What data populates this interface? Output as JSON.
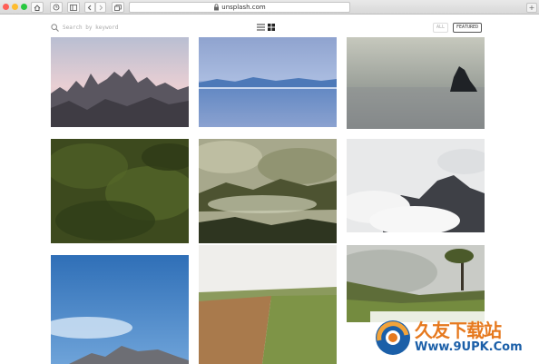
{
  "browser": {
    "address_bar": "unsplash.com",
    "new_tab_label": "+",
    "traffic_colors": [
      "#ff5f57",
      "#febc2e",
      "#28c840"
    ]
  },
  "toolbar": {
    "search_placeholder": "Search by keyword",
    "filter_all": "ALL",
    "filter_featured": "FEATURED"
  },
  "photos": [
    {
      "subject": "mountain-peaks-pink-sky"
    },
    {
      "subject": "blue-mountain-lake"
    },
    {
      "subject": "sea-rock-fog"
    },
    {
      "subject": "green-forest-aerial"
    },
    {
      "subject": "misty-green-hills"
    },
    {
      "subject": "cloudy-mountains"
    },
    {
      "subject": "blue-sky-mountain"
    },
    {
      "subject": "farm-field"
    },
    {
      "subject": "foggy-tree-meadow"
    }
  ],
  "watermark": {
    "brand": "久友下载站",
    "url": "Www.9UPK.Com"
  }
}
